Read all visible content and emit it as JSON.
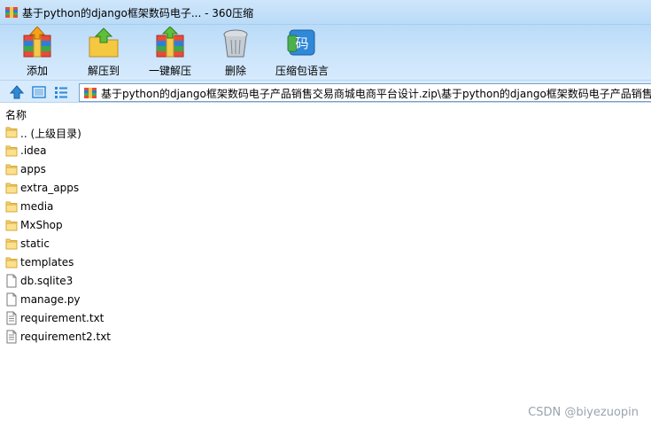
{
  "window": {
    "title": "基于python的django框架数码电子... - 360压缩"
  },
  "toolbar": {
    "buttons": [
      {
        "label": "添加",
        "icon": "add-archive-icon"
      },
      {
        "label": "解压到",
        "icon": "extract-to-icon"
      },
      {
        "label": "一键解压",
        "icon": "one-click-extract-icon"
      },
      {
        "label": "删除",
        "icon": "delete-trash-icon"
      },
      {
        "label": "压缩包语言",
        "icon": "archive-language-icon"
      }
    ],
    "language_glyph": "码"
  },
  "addressbar": {
    "path": "基于python的django框架数码电子产品销售交易商城电商平台设计.zip\\基于python的django框架数码电子产品销售交"
  },
  "list": {
    "column_name": "名称",
    "items": [
      {
        "name": ".. (上级目录)",
        "type": "folder"
      },
      {
        "name": ".idea",
        "type": "folder"
      },
      {
        "name": "apps",
        "type": "folder"
      },
      {
        "name": "extra_apps",
        "type": "folder"
      },
      {
        "name": "media",
        "type": "folder"
      },
      {
        "name": "MxShop",
        "type": "folder"
      },
      {
        "name": "static",
        "type": "folder"
      },
      {
        "name": "templates",
        "type": "folder"
      },
      {
        "name": "db.sqlite3",
        "type": "file"
      },
      {
        "name": "manage.py",
        "type": "file"
      },
      {
        "name": "requirement.txt",
        "type": "text"
      },
      {
        "name": "requirement2.txt",
        "type": "text"
      }
    ]
  },
  "watermark": "CSDN @biyezuopin"
}
